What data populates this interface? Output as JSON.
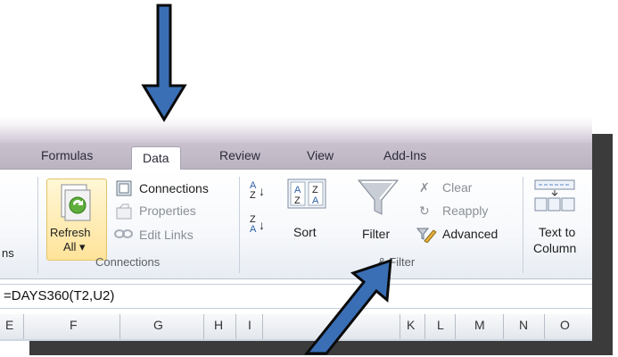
{
  "tabs": [
    "Formulas",
    "Data",
    "Review",
    "View",
    "Add-Ins"
  ],
  "active_tab": "Data",
  "connections": {
    "refresh_label_1": "Refresh",
    "refresh_label_2": "All ▾",
    "connections": "Connections",
    "properties": "Properties",
    "edit_links": "Edit Links",
    "group_label": "Connections",
    "left_cut_label": "ns"
  },
  "sort_filter": {
    "sort": "Sort",
    "filter": "Filter",
    "clear": "Clear",
    "reapply": "Reapply",
    "advanced": "Advanced",
    "group_label": "& Filter",
    "az_top": "A",
    "az_bottom": "Z",
    "za_top": "Z",
    "za_bottom": "A"
  },
  "data_tools": {
    "text_to_1": "Text to",
    "text_to_2": "Column"
  },
  "formula": "=DAYS360(T2,U2)",
  "columns": [
    "E",
    "F",
    "G",
    "H",
    "I",
    "K",
    "L",
    "M",
    "N",
    "O"
  ],
  "colors": {
    "arrow": "#3a6fb5",
    "arrow_outline": "#0a0a0a"
  }
}
